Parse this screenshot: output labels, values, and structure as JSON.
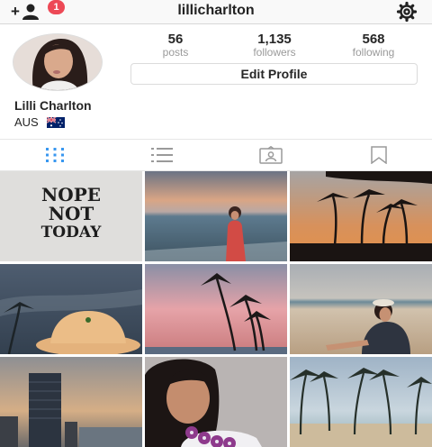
{
  "header": {
    "username": "lillicharlton",
    "notification_count": "1",
    "add_icon": "add-user-icon",
    "settings_icon": "gear-icon"
  },
  "profile": {
    "full_name": "Lilli Charlton",
    "location": "AUS",
    "flag_icon": "australia-flag",
    "edit_button_label": "Edit Profile",
    "stats": [
      {
        "value": "56",
        "label": "posts"
      },
      {
        "value": "1,135",
        "label": "followers"
      },
      {
        "value": "568",
        "label": "following"
      }
    ]
  },
  "tabs": [
    {
      "icon": "grid-icon",
      "active": true
    },
    {
      "icon": "list-icon",
      "active": false
    },
    {
      "icon": "tagged-icon",
      "active": false
    },
    {
      "icon": "bookmark-icon",
      "active": false
    }
  ],
  "posts": [
    {
      "text_lines": [
        "NOPE",
        "NOT",
        "TODAY"
      ]
    },
    {},
    {},
    {},
    {},
    {},
    {},
    {},
    {}
  ],
  "colors": {
    "badge": "#ed4956",
    "active_tab": "#3897f0",
    "muted": "#9a9a9a"
  }
}
